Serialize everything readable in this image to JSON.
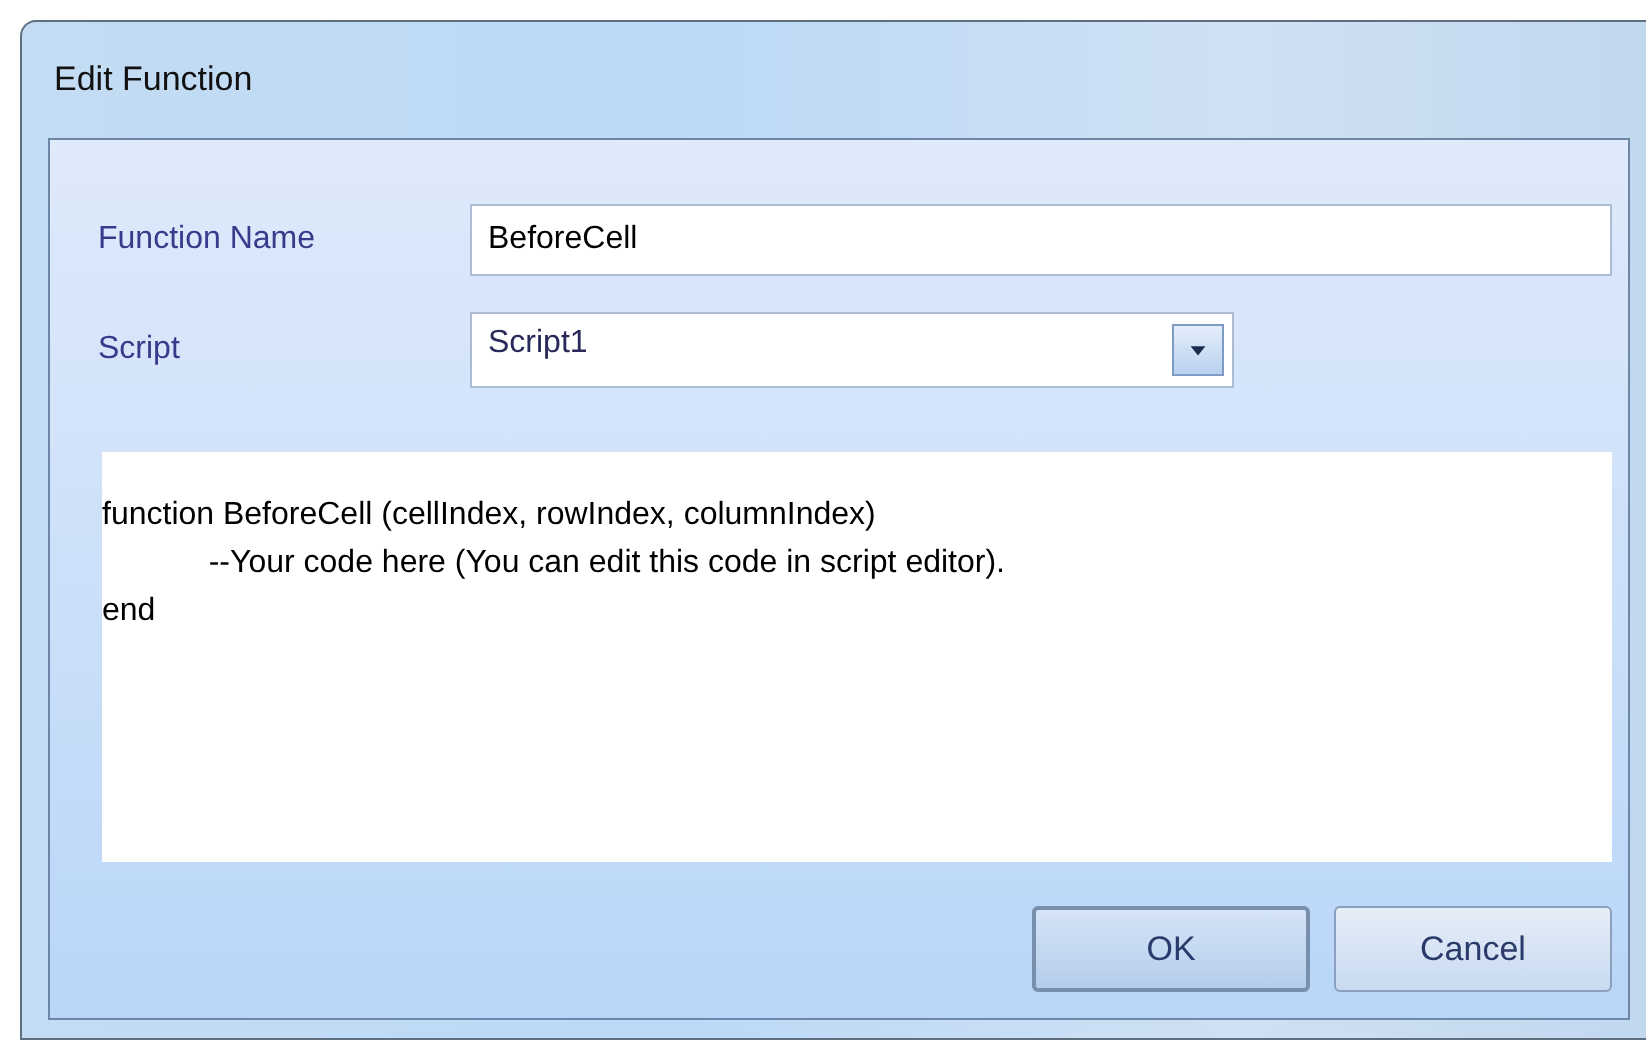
{
  "window": {
    "title": "Edit Function"
  },
  "fields": [
    {
      "kind": "text",
      "label": "Function Name",
      "value": "BeforeCell"
    },
    {
      "kind": "dropdown",
      "label": "Script",
      "value": "Script1"
    }
  ],
  "code": "function BeforeCell (cellIndex, rowIndex, columnIndex)\n\t\t--Your code here (You can edit this code in script editor).\nend",
  "buttons": [
    {
      "label": "OK",
      "default": true
    },
    {
      "label": "Cancel",
      "default": false
    }
  ]
}
